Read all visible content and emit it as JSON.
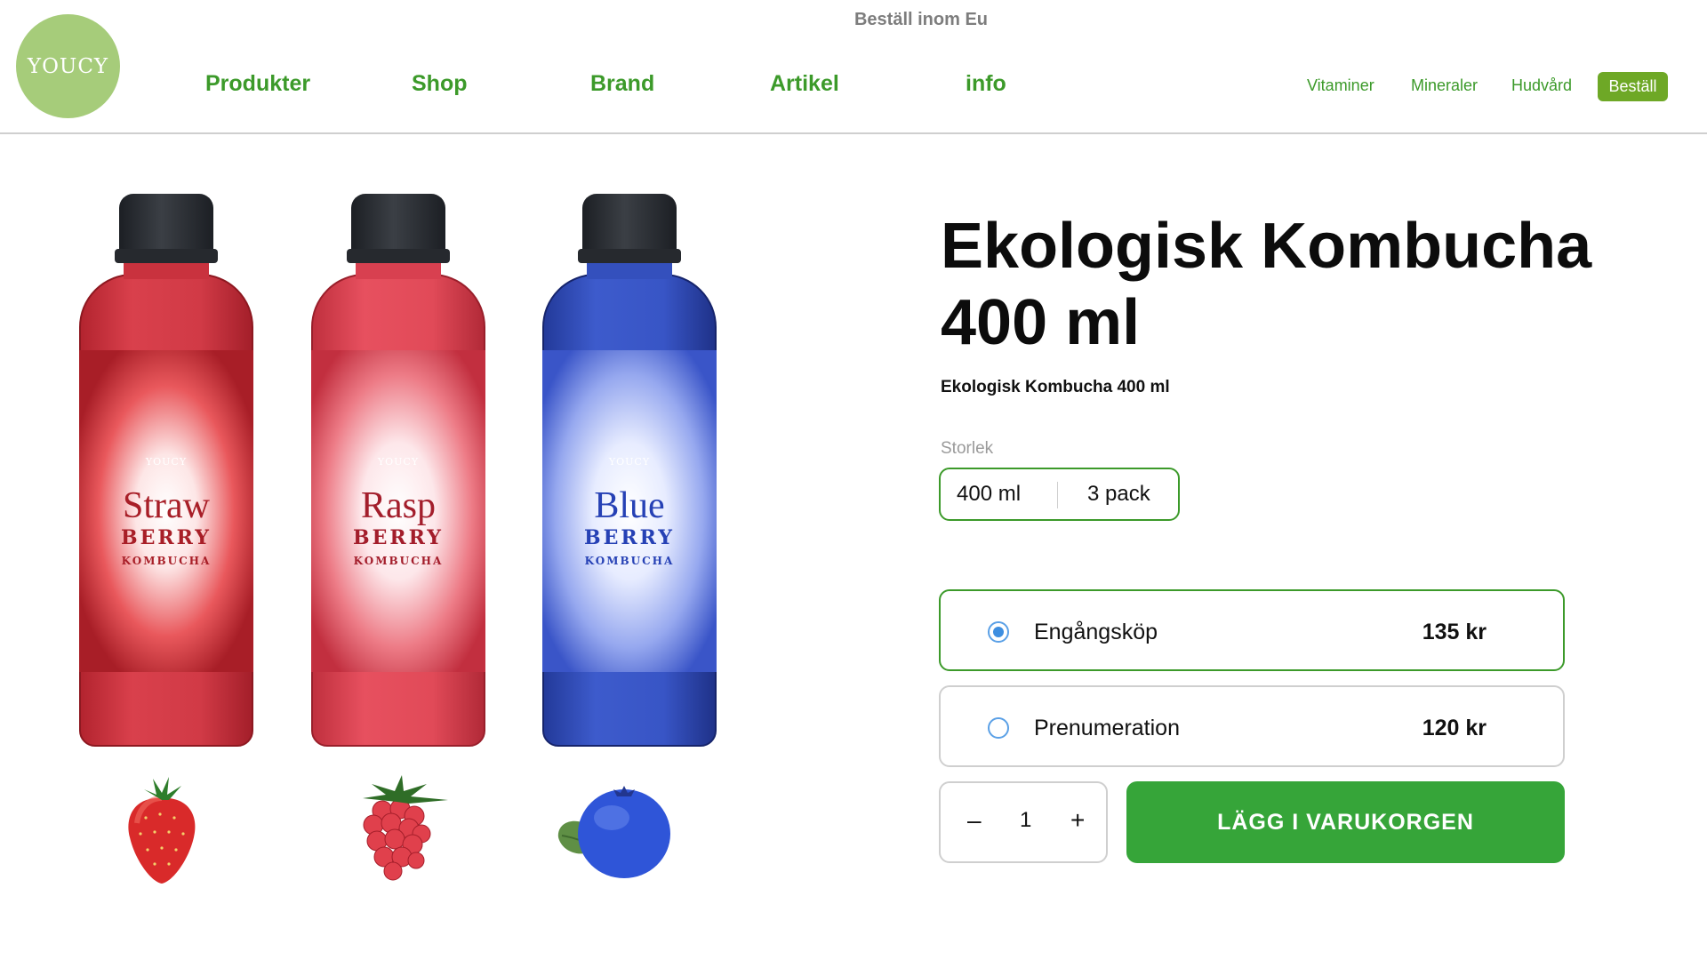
{
  "header": {
    "announcement": "Beställ inom Eu",
    "logo_text": "YOUCY",
    "nav_main": [
      "Produkter",
      "Shop",
      "Brand",
      "Artikel",
      "info"
    ],
    "nav_right": [
      "Vitaminer",
      "Mineraler",
      "Hudvård"
    ],
    "order_button": "Beställ"
  },
  "gallery": {
    "bottles": [
      {
        "brand": "YOUCY",
        "script": "Straw",
        "big": "BERRY",
        "small": "KOMBUCHA"
      },
      {
        "brand": "YOUCY",
        "script": "Rasp",
        "big": "BERRY",
        "small": "KOMBUCHA"
      },
      {
        "brand": "YOUCY",
        "script": "Blue",
        "big": "BERRY",
        "small": "KOMBUCHA"
      }
    ],
    "fruits": [
      "strawberry-icon",
      "raspberry-icon",
      "blueberry-icon"
    ]
  },
  "product": {
    "title": "Ekologisk Kombucha 400 ml",
    "subtitle": "Ekologisk Kombucha 400 ml",
    "size_label": "Storlek",
    "sizes": [
      "400 ml",
      "3 pack"
    ],
    "options": [
      {
        "label": "Engångsköp",
        "price": "135 kr",
        "selected": true
      },
      {
        "label": "Prenumeration",
        "price": "120 kr",
        "selected": false
      }
    ],
    "quantity": {
      "minus": "–",
      "value": "1",
      "plus": "+"
    },
    "cart_button": "LÄGG I VARUKORGEN"
  },
  "colors": {
    "accent_green": "#3c9a2a",
    "cart_green": "#36a539",
    "order_green": "#6ea826",
    "logo_green": "#a6cc7a",
    "radio_blue": "#3d8ee0"
  }
}
